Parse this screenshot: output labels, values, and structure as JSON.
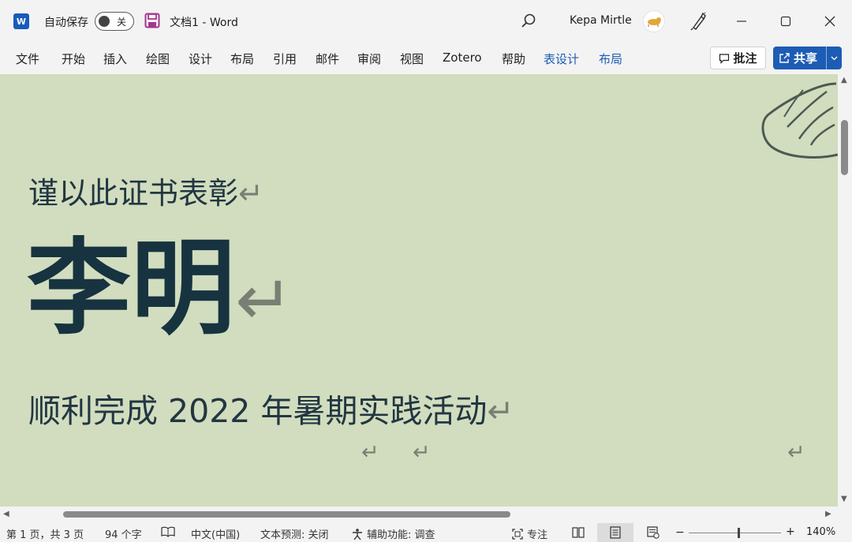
{
  "titlebar": {
    "app_icon_letter": "W",
    "autosave_label": "自动保存",
    "autosave_state": "关",
    "document_name": "文档1",
    "separator": "-",
    "app_name": "Word",
    "user_name": "Kepa Mirtle"
  },
  "ribbon": {
    "tabs": [
      "文件",
      "开始",
      "插入",
      "绘图",
      "设计",
      "布局",
      "引用",
      "邮件",
      "审阅",
      "视图",
      "Zotero",
      "帮助"
    ],
    "context_tabs": [
      "表设计",
      "布局"
    ],
    "comment_label": "批注",
    "share_label": "共享"
  },
  "document": {
    "intro": "谨以此证书表彰",
    "name": "李明",
    "completion": "顺利完成 2022 年暑期实践活动",
    "paragraph_mark": "↵",
    "background_color": "#d1ddbe",
    "text_color": "#173340"
  },
  "statusbar": {
    "page_info": "第 1 页，共 3 页",
    "word_count": "94 个字",
    "language": "中文(中国)",
    "text_prediction": "文本预测: 关闭",
    "accessibility": "辅助功能: 调查",
    "focus": "专注",
    "zoom_minus": "−",
    "zoom_plus": "+",
    "zoom_level": "140%"
  },
  "colors": {
    "accent": "#1d5cb4",
    "word_blue": "#185abd",
    "chrome_bg": "#f3f3f3"
  },
  "icons": [
    "word-logo-icon",
    "save-icon",
    "search-icon",
    "pen-icon",
    "minimize-icon",
    "maximize-icon",
    "close-icon",
    "comment-icon",
    "share-icon",
    "chevron-down-icon",
    "proofing-icon",
    "accessibility-icon",
    "focus-icon",
    "read-mode-icon",
    "print-layout-icon",
    "web-layout-icon"
  ]
}
